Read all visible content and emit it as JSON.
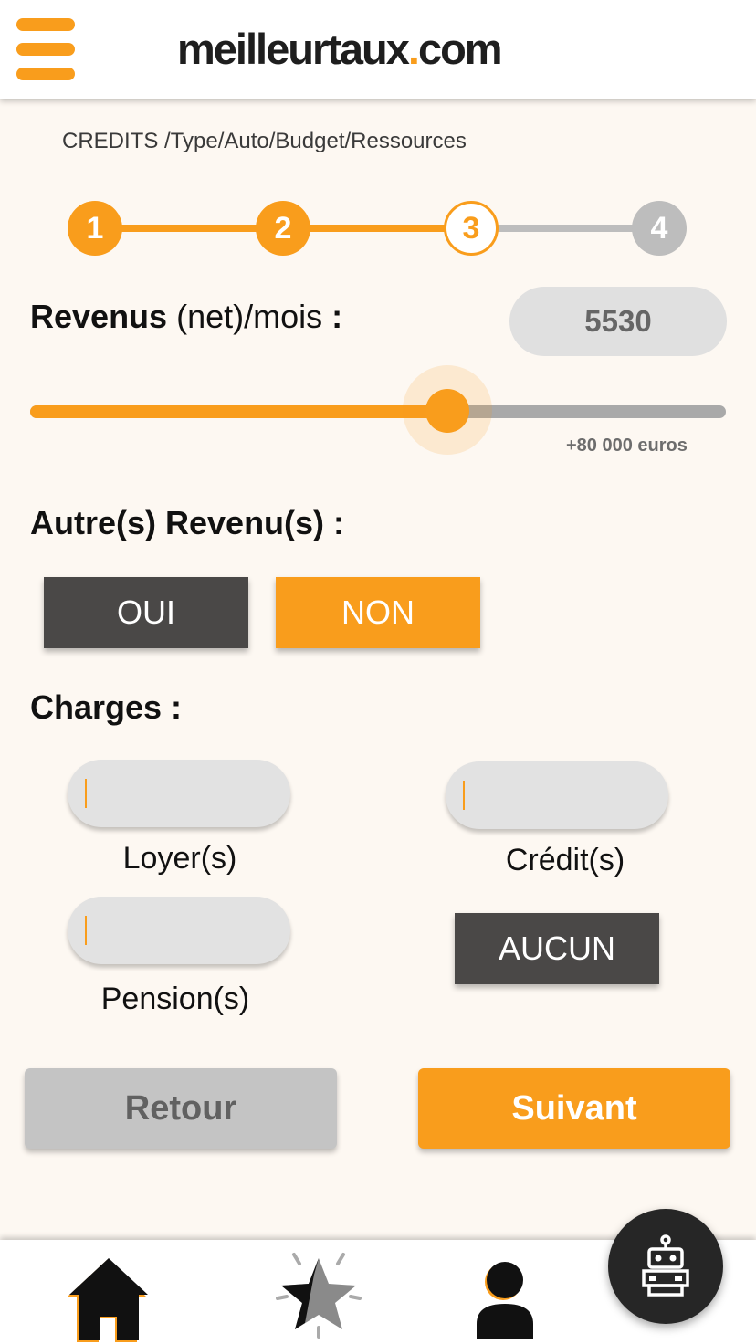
{
  "header": {
    "menu_icon": "hamburger-menu-icon",
    "logo_main": "meilleurtaux",
    "logo_dot": ".",
    "logo_tld": "com",
    "brand_color": "#f99d1c"
  },
  "breadcrumb": "CREDITS /Type/Auto/Budget/Ressources",
  "stepper": {
    "steps": [
      {
        "label": "1",
        "state": "done"
      },
      {
        "label": "2",
        "state": "done"
      },
      {
        "label": "3",
        "state": "current"
      },
      {
        "label": "4",
        "state": "todo"
      }
    ]
  },
  "revenus": {
    "label_bold": "Revenus",
    "label_rest": " (net)/mois ",
    "label_colon": ":",
    "value": "5530",
    "slider_fraction": 0.6,
    "slider_max_label": "+80 000 euros"
  },
  "autres_revenus": {
    "title": "Autre(s) Revenu(s) :",
    "oui": "OUI",
    "non": "NON",
    "selected": "NON"
  },
  "charges": {
    "title": "Charges :",
    "loyers_label": "Loyer(s)",
    "loyers_value": "",
    "credits_label": "Crédit(s)",
    "credits_value": "",
    "pensions_label": "Pension(s)",
    "pensions_value": "",
    "aucun": "AUCUN"
  },
  "actions": {
    "back": "Retour",
    "next": "Suivant"
  },
  "bottom_nav": {
    "icons": [
      "home-icon",
      "favorites-star-icon",
      "user-profile-icon"
    ],
    "chatbot_icon": "robot-icon"
  }
}
